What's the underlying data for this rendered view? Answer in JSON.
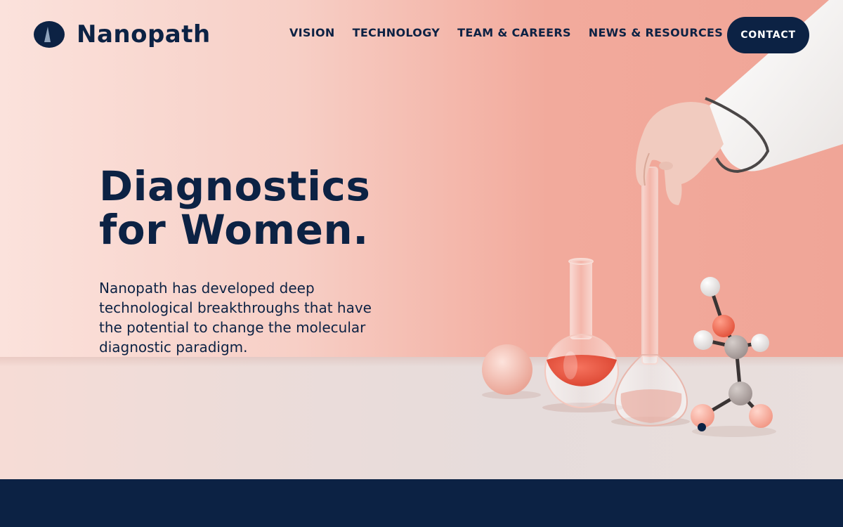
{
  "brand": {
    "name": "Nanopath",
    "logo_icon": "nanopath-logo-icon",
    "primary_color": "#0c2244"
  },
  "nav": {
    "items": [
      {
        "label": "VISION"
      },
      {
        "label": "TECHNOLOGY"
      },
      {
        "label": "TEAM & CAREERS"
      },
      {
        "label": "NEWS & RESOURCES"
      }
    ],
    "contact_label": "CONTACT"
  },
  "hero": {
    "headline_line1": "Diagnostics",
    "headline_line2": "for Women.",
    "subcopy": "Nanopath has developed deep technological breakthroughs that have the potential to change the molecular diagnostic paradigm.",
    "image_subject": "lab-glassware-scene"
  },
  "colors": {
    "hero_gradient_start": "#fbe2dc",
    "hero_gradient_end": "#f0a597",
    "flask_liquid": "#ee5a44",
    "footer_band": "#0c2244"
  }
}
